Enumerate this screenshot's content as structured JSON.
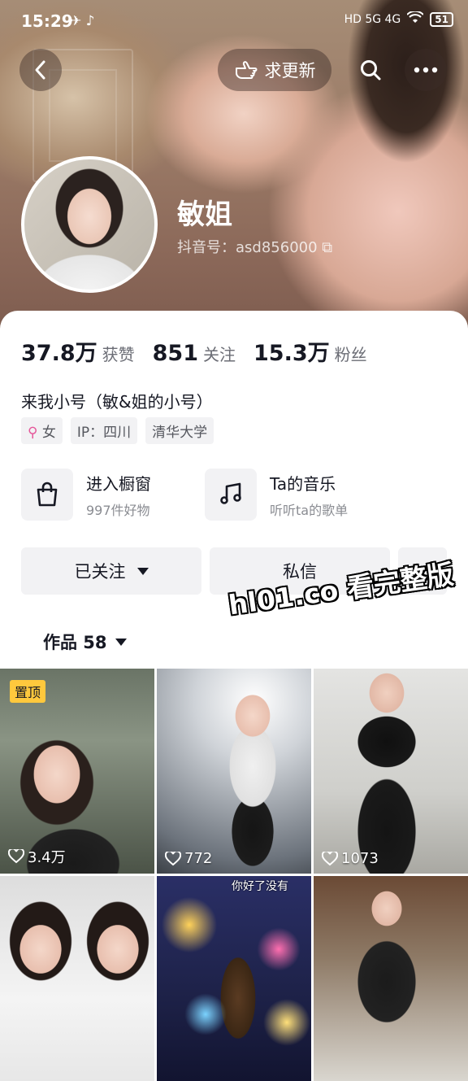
{
  "status_bar": {
    "time": "15:29",
    "apps": "✈ ♪",
    "network": "HD 5G 4G",
    "battery": "51"
  },
  "header": {
    "update_label": "求更新"
  },
  "profile": {
    "name": "敏姐",
    "douyin_id": "抖音号：asd856000",
    "copy_glyph": "⧉"
  },
  "stats": [
    {
      "value": "37.8万",
      "label": "获赞"
    },
    {
      "value": "851",
      "label": "关注"
    },
    {
      "value": "15.3万",
      "label": "粉丝"
    }
  ],
  "bio": "来我小号（敏&姐的小号）",
  "tags": {
    "gender_symbol": "⚲",
    "gender": "女",
    "ip": "IP：四川",
    "school": "清华大学"
  },
  "shortcuts": {
    "showcase": {
      "title": "进入橱窗",
      "subtitle": "997件好物"
    },
    "music": {
      "title": "Ta的音乐",
      "subtitle": "听听ta的歌单"
    }
  },
  "actions": {
    "follow": "已关注",
    "message": "私信"
  },
  "works_tab": {
    "label": "作品 58"
  },
  "watermark": "hl01.co 看完整版",
  "videos": [
    {
      "likes": "3.4万",
      "pinned": "置顶"
    },
    {
      "likes": "772"
    },
    {
      "likes": "1073"
    },
    {
      "likes": ""
    },
    {
      "likes": "",
      "caption": "你好了没有"
    },
    {
      "likes": ""
    }
  ],
  "colors": {
    "accent_pin": "#ffc83d",
    "gender_pink": "#e5579a",
    "card_bg": "#ffffff",
    "chip_bg": "#f2f2f4"
  }
}
